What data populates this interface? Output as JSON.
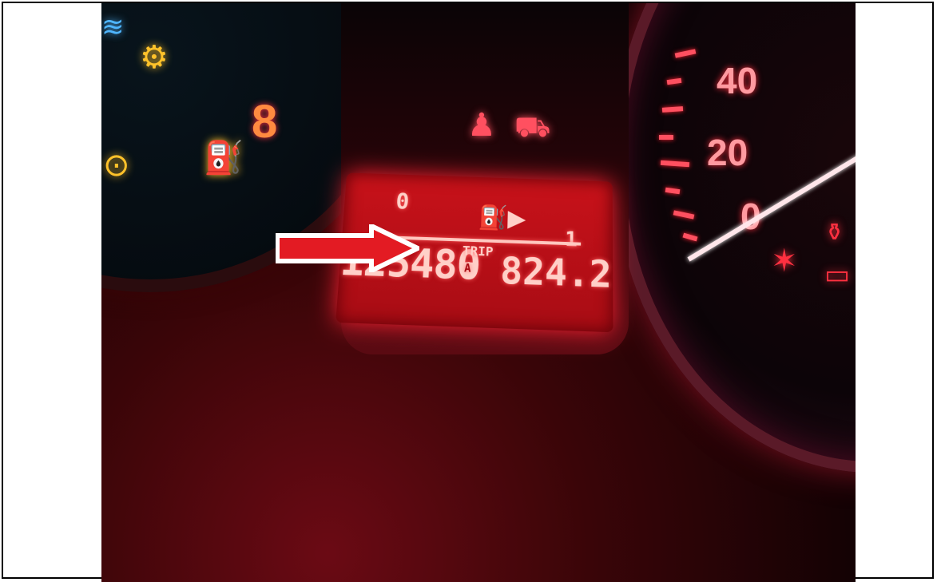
{
  "photo": {
    "odometer": "125480",
    "trip_label": "TRIP",
    "trip_sub_label": "A",
    "trip_value": "824.2",
    "fuel_gauge_empty": "0",
    "fuel_gauge_full": "1",
    "speedometer_labels": [
      "40",
      "20",
      "0"
    ],
    "tachometer_label": "8",
    "icons": [
      "check-engine-icon",
      "fuel-cap-icon",
      "seatbelt-icon",
      "door-ajar-icon",
      "airbag-icon",
      "battery-icon",
      "oil-icon"
    ],
    "accent_red": "#e31b23",
    "lcd_red": "#c8121a"
  }
}
